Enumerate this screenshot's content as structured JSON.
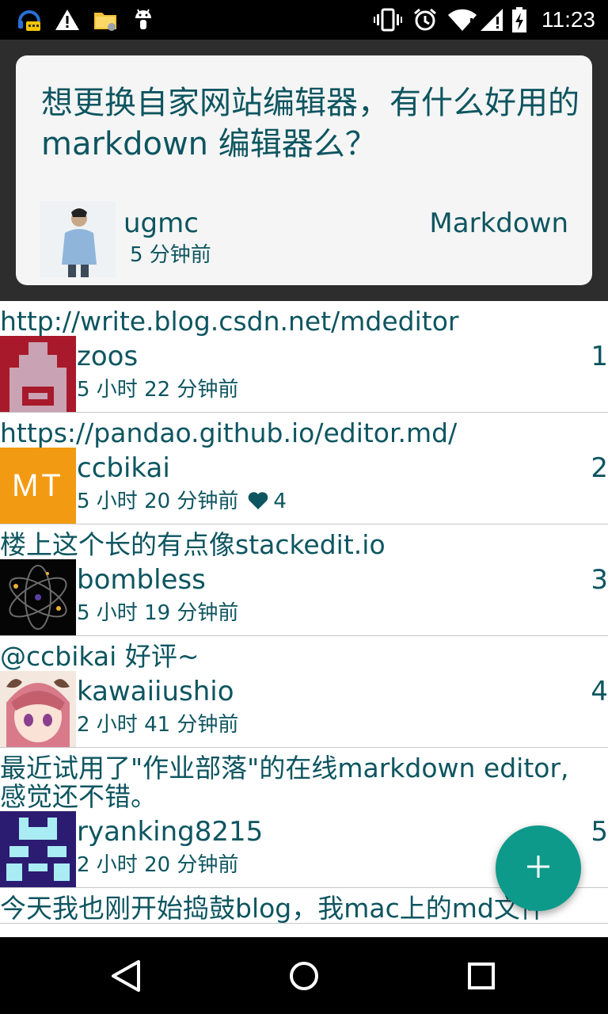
{
  "status_bar": {
    "time": "11:23",
    "icons": [
      "headset-notification-icon",
      "warning-icon",
      "file-manager-icon",
      "android-debug-icon",
      "vibrate-icon",
      "alarm-icon",
      "wifi-icon",
      "signal-icon",
      "battery-icon"
    ]
  },
  "question": {
    "title": "想更换自家网站编辑器，有什么好用的 markdown 编辑器么？",
    "author": "ugmc",
    "time": "5 分钟前",
    "tag": "Markdown"
  },
  "answers": [
    {
      "content": "http://write.blog.csdn.net/mdeditor",
      "author": "zoos",
      "time": "5 小时 22 分钟前",
      "floor": "1"
    },
    {
      "content": "https://pandao.github.io/editor.md/",
      "author": "ccbikai",
      "time": "5 小时 20 分钟前",
      "likes": "4",
      "floor": "2",
      "avatar_text": "MT"
    },
    {
      "content": "楼上这个长的有点像stackedit.io",
      "author": "bombless",
      "time": "5 小时 19 分钟前",
      "floor": "3"
    },
    {
      "content": "@ccbikai 好评~",
      "author": "kawaiiushio",
      "time": "2 小时 41 分钟前",
      "floor": "4"
    },
    {
      "content": "最近试用了\"作业部落\"的在线markdown editor, 感觉还不错。",
      "author": "ryanking8215",
      "time": "2 小时 20 分钟前",
      "floor": "5"
    },
    {
      "content": "今天我也刚开始捣鼓blog，我mac上的md文件"
    }
  ],
  "fab": {
    "icon": "plus-icon"
  },
  "nav": {
    "icons": [
      "back-icon",
      "home-icon",
      "recents-icon"
    ]
  },
  "colors": {
    "text": "#0d5560",
    "fab": "#0d9a8a",
    "card": "#f5f5f5",
    "backdrop": "#2d2d2d"
  }
}
